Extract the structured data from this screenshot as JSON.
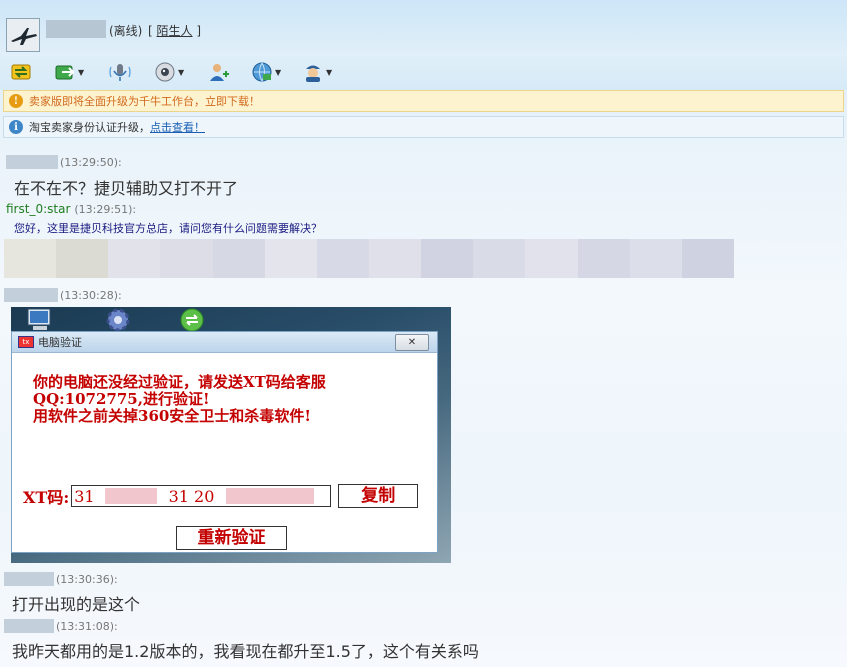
{
  "header": {
    "status": "(离线)",
    "stranger_prefix": "[",
    "stranger_label": "陌生人",
    "stranger_suffix": "]"
  },
  "toolbar": [
    {
      "icon": "transfer-icon",
      "has_menu": false
    },
    {
      "icon": "send-file-icon",
      "has_menu": true
    },
    {
      "icon": "voice-mic-icon",
      "has_menu": false
    },
    {
      "icon": "webcam-icon",
      "has_menu": true
    },
    {
      "icon": "add-contact-icon",
      "has_menu": false
    },
    {
      "icon": "remote-desktop-icon",
      "has_menu": true
    },
    {
      "icon": "more-apps-icon",
      "has_menu": true
    }
  ],
  "notices": {
    "seller": "卖家版即将全面升级为千牛工作台，立即下载！",
    "verify_text": "淘宝卖家身份认证升级，",
    "verify_link": "点击查看！"
  },
  "messages": [
    {
      "time": "(13:29:50):",
      "text": "在不在不？捷贝辅助又打不开了"
    },
    {
      "sender": "first_0:star",
      "time": "(13:29:51):",
      "text": "您好，这里是捷贝科技官方总店，请问您有什么问题需要解决？"
    },
    {
      "time": "(13:30:28):"
    },
    {
      "time": "(13:30:36):",
      "text": "打开出现的是这个"
    },
    {
      "time": "(13:31:08):",
      "text": "我昨天都用的是1.2版本的，我看现在都升至1.5了，这个有关系吗"
    }
  ],
  "pixel_strip_colors": [
    "#e6e6df",
    "#dbdad3",
    "#e2e3ea",
    "#dcdde6",
    "#d6d8e4",
    "#e3e4ec",
    "#d7d9e6",
    "#dfe0ea",
    "#d1d3e2",
    "#d9dbe7",
    "#e1e2eb",
    "#d5d7e4",
    "#dcdee9",
    "#cfd2e1"
  ],
  "screenshot": {
    "dialog_title": "电脑验证",
    "close_label": "✕",
    "warn_line1": "你的电脑还没经过验证，请发送XT码给客服",
    "warn_line2": "QQ:1072775,进行验证!",
    "warn_line3": "用软件之前关掉360安全卫士和杀毒软件!",
    "xt_label": "XT码:",
    "xt_part1": "31",
    "xt_part2": "31 20",
    "copy_label": "复制",
    "reverify_label": "重新验证"
  },
  "colors": {
    "accent_red": "#c40000",
    "sender_green": "#1f7d1f",
    "link_blue": "#1a5fb4",
    "notice_orange": "#d2691e"
  }
}
